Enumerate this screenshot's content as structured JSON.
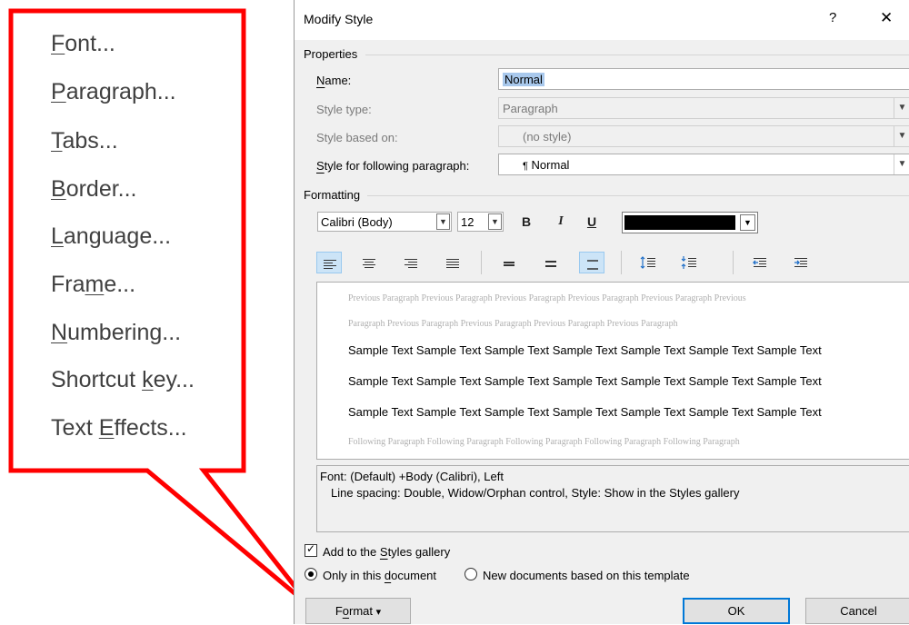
{
  "callout_menu": {
    "border_color": "#ff0000",
    "items": [
      {
        "before": "",
        "key": "F",
        "after": "ont..."
      },
      {
        "before": "",
        "key": "P",
        "after": "aragraph..."
      },
      {
        "before": "",
        "key": "T",
        "after": "abs..."
      },
      {
        "before": "",
        "key": "B",
        "after": "order..."
      },
      {
        "before": "",
        "key": "L",
        "after": "anguage..."
      },
      {
        "before": "Fra",
        "key": "m",
        "after": "e..."
      },
      {
        "before": "",
        "key": "N",
        "after": "umbering..."
      },
      {
        "before": "Shortcut ",
        "key": "k",
        "after": "ey..."
      },
      {
        "before": "Text ",
        "key": "E",
        "after": "ffects..."
      }
    ]
  },
  "dialog": {
    "title": "Modify Style",
    "help": "?",
    "close": "✕",
    "properties": {
      "group_label": "Properties",
      "name": {
        "label_key": "N",
        "label_rest": "ame:",
        "value": "Normal"
      },
      "style_type": {
        "label": "Style type:",
        "value": "Paragraph"
      },
      "based_on": {
        "label": "Style based on:",
        "value": "(no style)"
      },
      "following": {
        "label_key": "S",
        "label_rest": "tyle for following paragraph:",
        "mark": "¶",
        "value": "Normal"
      }
    },
    "formatting": {
      "group_label": "Formatting",
      "font": "Calibri (Body)",
      "size": "12",
      "bold": "B",
      "italic": "I",
      "underline": "U",
      "font_color": "#000000"
    },
    "preview": {
      "previous": [
        "Previous Paragraph Previous Paragraph Previous Paragraph Previous Paragraph Previous Paragraph Previous",
        "Paragraph Previous Paragraph Previous Paragraph Previous Paragraph Previous Paragraph"
      ],
      "sample": [
        "Sample Text Sample Text Sample Text Sample Text Sample Text Sample Text Sample Text",
        "Sample Text Sample Text Sample Text Sample Text Sample Text Sample Text Sample Text",
        "Sample Text Sample Text Sample Text Sample Text Sample Text Sample Text Sample Text"
      ],
      "following": "Following Paragraph Following Paragraph Following Paragraph Following Paragraph Following Paragraph"
    },
    "description": {
      "line1": "Font: (Default) +Body (Calibri), Left",
      "line2": "Line spacing:  Double, Widow/Orphan control, Style: Show in the Styles gallery"
    },
    "add_to_gallery": {
      "before": "Add to the ",
      "key": "S",
      "after": "tyles gallery",
      "checked": true
    },
    "only_this_doc": {
      "before": "Only in this ",
      "key": "d",
      "after": "ocument",
      "selected": true
    },
    "new_docs": {
      "label": "New documents based on this template",
      "selected": false
    },
    "buttons": {
      "format": {
        "before": "F",
        "key": "o",
        "after": "rmat",
        "arrow": "▾"
      },
      "ok": "OK",
      "cancel": "Cancel"
    }
  }
}
